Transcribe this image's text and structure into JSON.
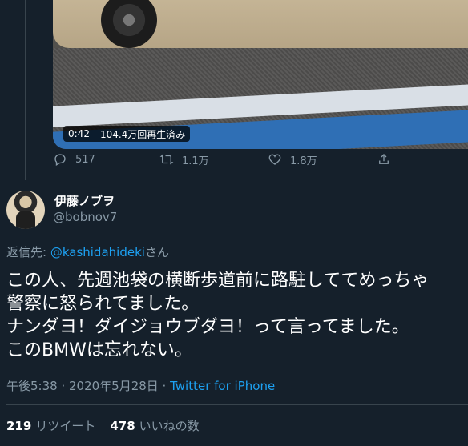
{
  "previous_tweet": {
    "video": {
      "duration": "0:42",
      "views": "104.4万回再生済み"
    },
    "actions": {
      "replies": "517",
      "retweets": "1.1万",
      "likes": "1.8万"
    }
  },
  "tweet": {
    "author": {
      "display_name": "伊藤ノブヲ",
      "handle": "@bobnov7"
    },
    "reply_to": {
      "prefix": "返信先: ",
      "mention": "@kashidahideki",
      "suffix": "さん"
    },
    "text_lines": [
      "この人、先週池袋の横断歩道前に路駐しててめっちゃ",
      "警察に怒られてました。",
      "ナンダヨ！ダイジョウブダヨ！って言ってました。",
      "このBMWは忘れない。"
    ],
    "meta": {
      "timestamp": "午後5:38 · 2020年5月28日 · ",
      "source": "Twitter for iPhone"
    },
    "stats": {
      "retweets_count": "219",
      "retweets_label": "リツイート",
      "likes_count": "478",
      "likes_label": "いいねの数"
    }
  },
  "icons": [
    "reply-icon",
    "retweet-icon",
    "like-icon",
    "share-icon"
  ],
  "colors": {
    "background": "#15202b",
    "secondary_text": "#8899a6",
    "link": "#1da1f2",
    "divider": "#38444d"
  }
}
